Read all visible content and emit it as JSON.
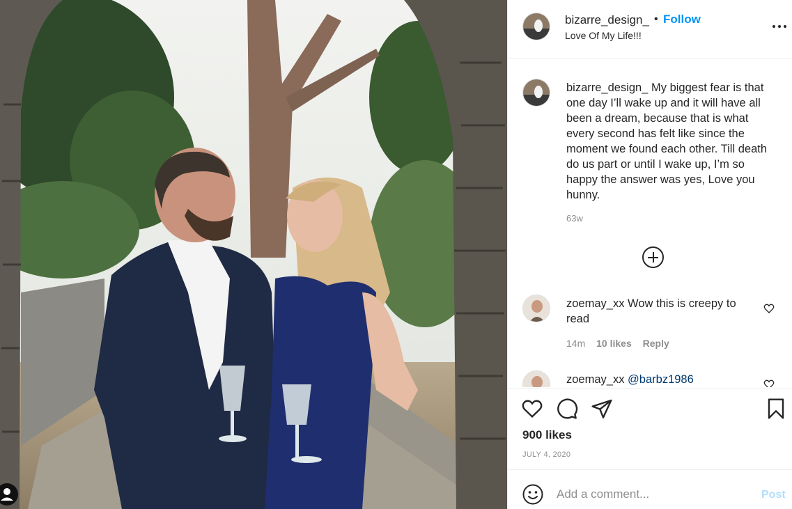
{
  "post": {
    "username": "bizarre_design_",
    "follow_label": "Follow",
    "separator": "•",
    "location": "Love Of My Life!!!",
    "more_label": "...",
    "caption": {
      "username": "bizarre_design_",
      "text": "My biggest fear is that one day I’ll wake up and it will have all been a dream, because that is what every second has felt like since the moment we found each other. Till death do us part or until I wake up, I’m so happy the answer was yes, Love you hunny.",
      "time": "63w"
    },
    "comments": [
      {
        "username": "zoemay_xx",
        "text": "Wow this is creepy to read",
        "time": "14m",
        "likes": "10 likes",
        "reply_label": "Reply"
      },
      {
        "username": "zoemay_xx",
        "mention": "@barbz1986"
      }
    ],
    "likes": "900 likes",
    "date": "JULY 4, 2020",
    "comment_input": {
      "placeholder": "Add a comment..."
    },
    "post_button": "Post"
  },
  "icons": [
    "ellipsis-icon",
    "plus-circle-icon",
    "heart-icon",
    "comment-icon",
    "share-icon",
    "bookmark-icon",
    "emoji-icon",
    "user-circle-icon"
  ],
  "colors": {
    "link_blue": "#0095f6",
    "post_disabled": "#b2dffc",
    "muted": "#8e8e8e",
    "mention": "#00376b"
  }
}
